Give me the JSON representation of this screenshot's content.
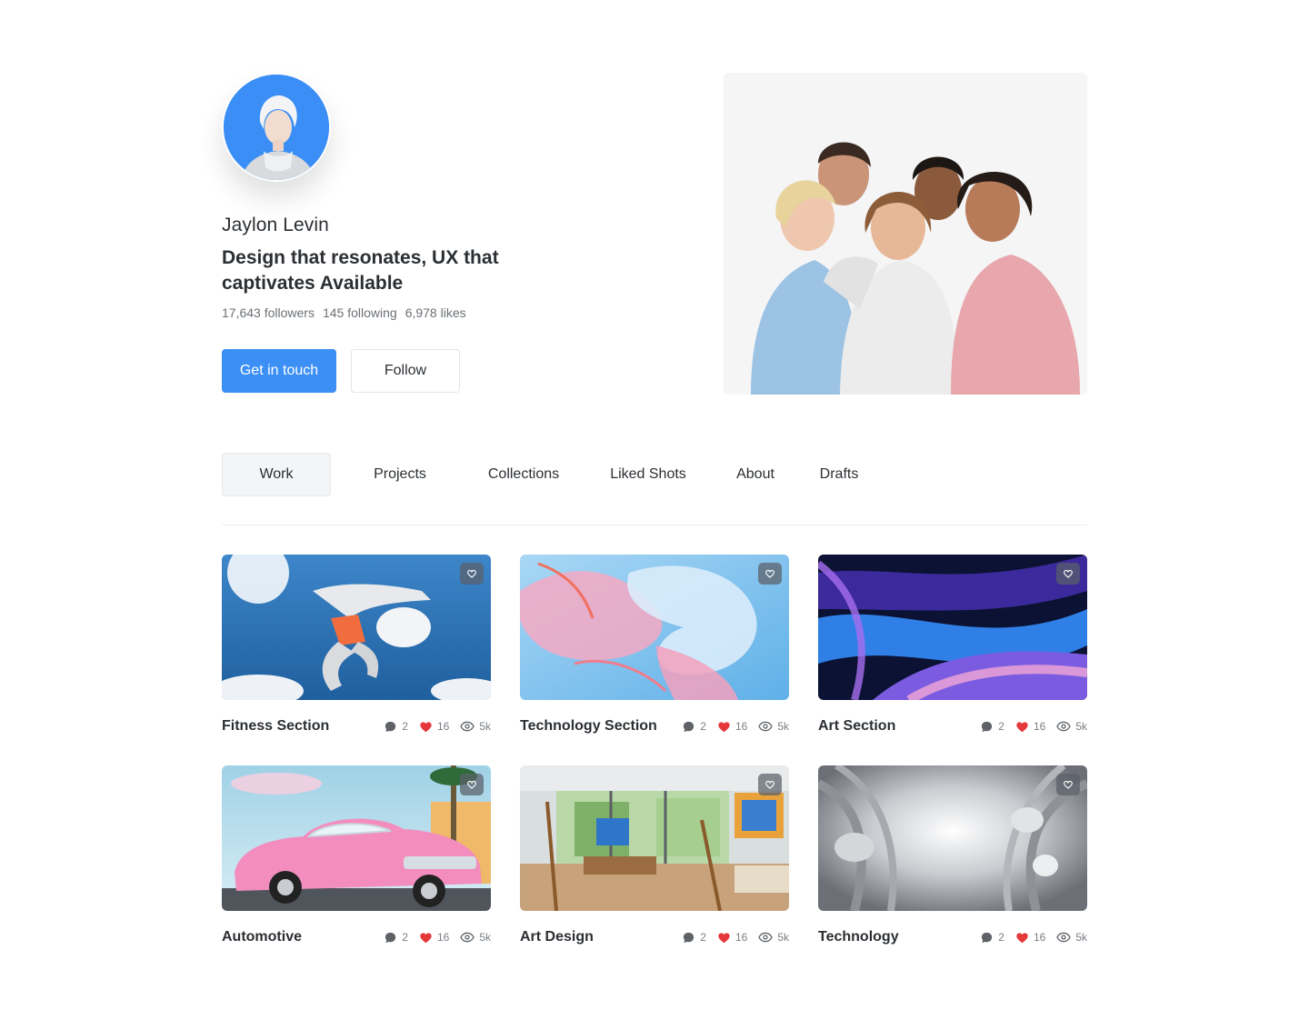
{
  "profile": {
    "name": "Jaylon Levin",
    "headline": "Design that resonates, UX that captivates Available",
    "stats": {
      "followers": "17,643 followers",
      "following": "145 following",
      "likes": "6,978 likes"
    },
    "primary_button": "Get in touch",
    "secondary_button": "Follow"
  },
  "tabs": [
    {
      "label": "Work",
      "active": true
    },
    {
      "label": "Projects",
      "active": false
    },
    {
      "label": "Collections",
      "active": false
    },
    {
      "label": "Liked Shots",
      "active": false
    },
    {
      "label": "About",
      "active": false
    },
    {
      "label": "Drafts",
      "active": false
    }
  ],
  "shots": [
    {
      "title": "Fitness Section",
      "comments": "2",
      "likes": "16",
      "views": "5k"
    },
    {
      "title": "Technology Section",
      "comments": "2",
      "likes": "16",
      "views": "5k"
    },
    {
      "title": "Art Section",
      "comments": "2",
      "likes": "16",
      "views": "5k"
    },
    {
      "title": "Automotive",
      "comments": "2",
      "likes": "16",
      "views": "5k"
    },
    {
      "title": "Art Design",
      "comments": "2",
      "likes": "16",
      "views": "5k"
    },
    {
      "title": "Technology",
      "comments": "2",
      "likes": "16",
      "views": "5k"
    }
  ],
  "colors": {
    "accent": "#3b8ff5",
    "like": "#e5383b"
  },
  "icons": {
    "comment": "comment-icon",
    "like": "heart-icon",
    "views": "eye-icon",
    "favorite": "heart-outline-icon"
  }
}
